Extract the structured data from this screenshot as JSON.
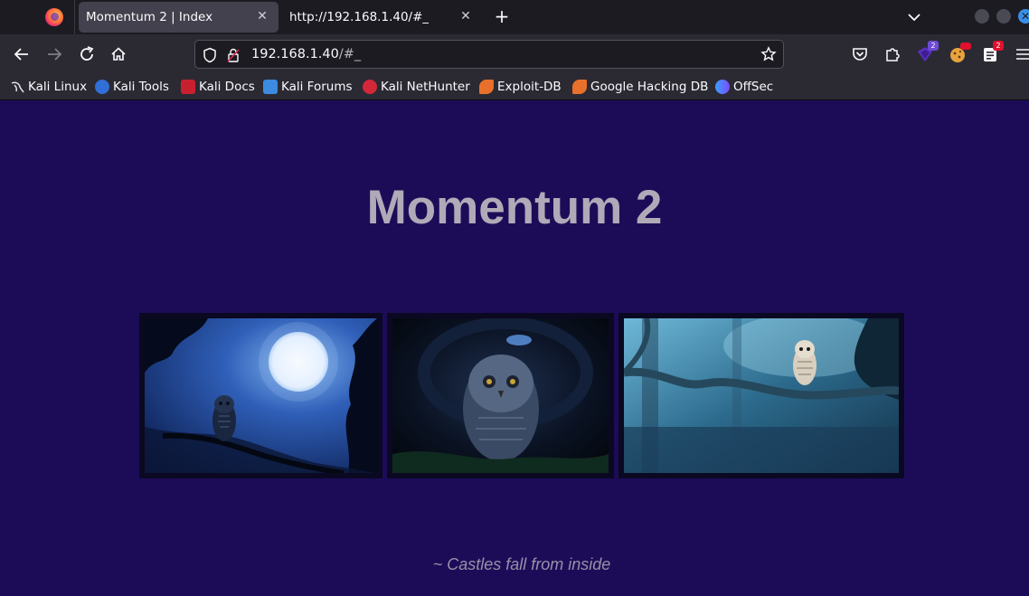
{
  "browser": {
    "tabs": [
      {
        "title": "Momentum 2 | Index",
        "active": true
      },
      {
        "title": "http://192.168.1.40/#_",
        "active": false
      }
    ],
    "url": {
      "host": "192.168.1.40",
      "path": "/#_"
    },
    "extension_badges": {
      "ublock": "2",
      "notes": "2"
    },
    "bookmarks": [
      {
        "label": "Kali Linux",
        "icon": "kali-dragon-icon"
      },
      {
        "label": "Kali Tools",
        "icon": "kali-tools-icon"
      },
      {
        "label": "Kali Docs",
        "icon": "kali-docs-icon"
      },
      {
        "label": "Kali Forums",
        "icon": "kali-forums-icon"
      },
      {
        "label": "Kali NetHunter",
        "icon": "nethunter-icon"
      },
      {
        "label": "Exploit-DB",
        "icon": "exploit-db-icon"
      },
      {
        "label": "Google Hacking DB",
        "icon": "ghdb-icon"
      },
      {
        "label": "OffSec",
        "icon": "offsec-icon"
      }
    ]
  },
  "page": {
    "title": "Momentum 2",
    "tagline": "~ Castles fall from inside",
    "background_color": "#1c0c58",
    "images": [
      {
        "subject": "owl on branch under full moon"
      },
      {
        "subject": "owl in dark cave"
      },
      {
        "subject": "barred owl on mossy branch in forest"
      }
    ]
  }
}
